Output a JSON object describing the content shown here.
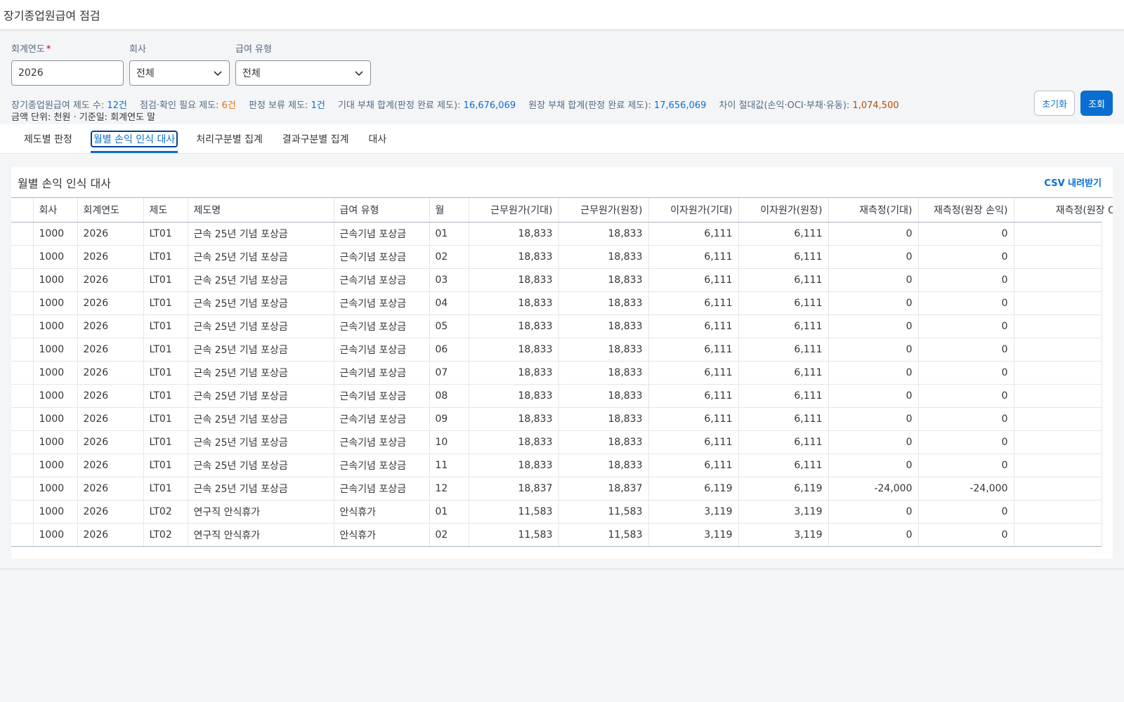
{
  "app": {
    "title": "장기종업원급여 점검"
  },
  "filters": {
    "year": {
      "label": "회계연도",
      "value": "2026"
    },
    "company": {
      "label": "회사",
      "value": "전체"
    },
    "benefit_type": {
      "label": "급여 유형",
      "value": "전체"
    }
  },
  "actions": {
    "reset_label": "초기화",
    "search_label": "조회"
  },
  "summary": {
    "plan_count_label": "장기종업원급여 제도 수:",
    "plan_count": "12건",
    "check_needed_label": "점검·확인 필요 제도:",
    "check_needed": "6건",
    "pending_label": "판정 보류 제도:",
    "pending": "1건",
    "expected_liab_label": "기대 부채 합계(판정 완료 제도):",
    "expected_liab": "16,676,069",
    "ledger_liab_label": "원장 부채 합계(판정 완료 제도):",
    "ledger_liab": "17,656,069",
    "diff_label": "차이 절대값(손익·OCI·부채·유동):",
    "diff": "1,074,500",
    "unit_note": "금액 단위: 천원 · 기준일: 회계연도 말"
  },
  "tabs": [
    {
      "label": "제도별 판정",
      "active": false
    },
    {
      "label": "월별 손익 인식 대사",
      "active": true
    },
    {
      "label": "처리구분별 집계",
      "active": false
    },
    {
      "label": "결과구분별 집계",
      "active": false
    },
    {
      "label": "대사",
      "active": false
    }
  ],
  "panel": {
    "title": "월별 손익 인식 대사",
    "csv_label": "CSV 내려받기"
  },
  "table": {
    "columns": [
      "",
      "회사",
      "회계연도",
      "제도",
      "제도명",
      "급여 유형",
      "월",
      "근무원가(기대)",
      "근무원가(원장)",
      "이자원가(기대)",
      "이자원가(원장)",
      "재측정(기대)",
      "재측정(원장 손익)",
      "재측정(원장 OCI)"
    ],
    "rows": [
      [
        "",
        "1000",
        "2026",
        "LT01",
        "근속 25년 기념 포상금",
        "근속기념 포상금",
        "01",
        "18,833",
        "18,833",
        "6,111",
        "6,111",
        "0",
        "0",
        ""
      ],
      [
        "",
        "1000",
        "2026",
        "LT01",
        "근속 25년 기념 포상금",
        "근속기념 포상금",
        "02",
        "18,833",
        "18,833",
        "6,111",
        "6,111",
        "0",
        "0",
        ""
      ],
      [
        "",
        "1000",
        "2026",
        "LT01",
        "근속 25년 기념 포상금",
        "근속기념 포상금",
        "03",
        "18,833",
        "18,833",
        "6,111",
        "6,111",
        "0",
        "0",
        ""
      ],
      [
        "",
        "1000",
        "2026",
        "LT01",
        "근속 25년 기념 포상금",
        "근속기념 포상금",
        "04",
        "18,833",
        "18,833",
        "6,111",
        "6,111",
        "0",
        "0",
        ""
      ],
      [
        "",
        "1000",
        "2026",
        "LT01",
        "근속 25년 기념 포상금",
        "근속기념 포상금",
        "05",
        "18,833",
        "18,833",
        "6,111",
        "6,111",
        "0",
        "0",
        ""
      ],
      [
        "",
        "1000",
        "2026",
        "LT01",
        "근속 25년 기념 포상금",
        "근속기념 포상금",
        "06",
        "18,833",
        "18,833",
        "6,111",
        "6,111",
        "0",
        "0",
        ""
      ],
      [
        "",
        "1000",
        "2026",
        "LT01",
        "근속 25년 기념 포상금",
        "근속기념 포상금",
        "07",
        "18,833",
        "18,833",
        "6,111",
        "6,111",
        "0",
        "0",
        ""
      ],
      [
        "",
        "1000",
        "2026",
        "LT01",
        "근속 25년 기념 포상금",
        "근속기념 포상금",
        "08",
        "18,833",
        "18,833",
        "6,111",
        "6,111",
        "0",
        "0",
        ""
      ],
      [
        "",
        "1000",
        "2026",
        "LT01",
        "근속 25년 기념 포상금",
        "근속기념 포상금",
        "09",
        "18,833",
        "18,833",
        "6,111",
        "6,111",
        "0",
        "0",
        ""
      ],
      [
        "",
        "1000",
        "2026",
        "LT01",
        "근속 25년 기념 포상금",
        "근속기념 포상금",
        "10",
        "18,833",
        "18,833",
        "6,111",
        "6,111",
        "0",
        "0",
        ""
      ],
      [
        "",
        "1000",
        "2026",
        "LT01",
        "근속 25년 기념 포상금",
        "근속기념 포상금",
        "11",
        "18,833",
        "18,833",
        "6,111",
        "6,111",
        "0",
        "0",
        ""
      ],
      [
        "",
        "1000",
        "2026",
        "LT01",
        "근속 25년 기념 포상금",
        "근속기념 포상금",
        "12",
        "18,837",
        "18,837",
        "6,119",
        "6,119",
        "-24,000",
        "-24,000",
        ""
      ],
      [
        "",
        "1000",
        "2026",
        "LT02",
        "연구직 안식휴가",
        "안식휴가",
        "01",
        "11,583",
        "11,583",
        "3,119",
        "3,119",
        "0",
        "0",
        ""
      ],
      [
        "",
        "1000",
        "2026",
        "LT02",
        "연구직 안식휴가",
        "안식휴가",
        "02",
        "11,583",
        "11,583",
        "3,119",
        "3,119",
        "0",
        "0",
        ""
      ]
    ]
  }
}
